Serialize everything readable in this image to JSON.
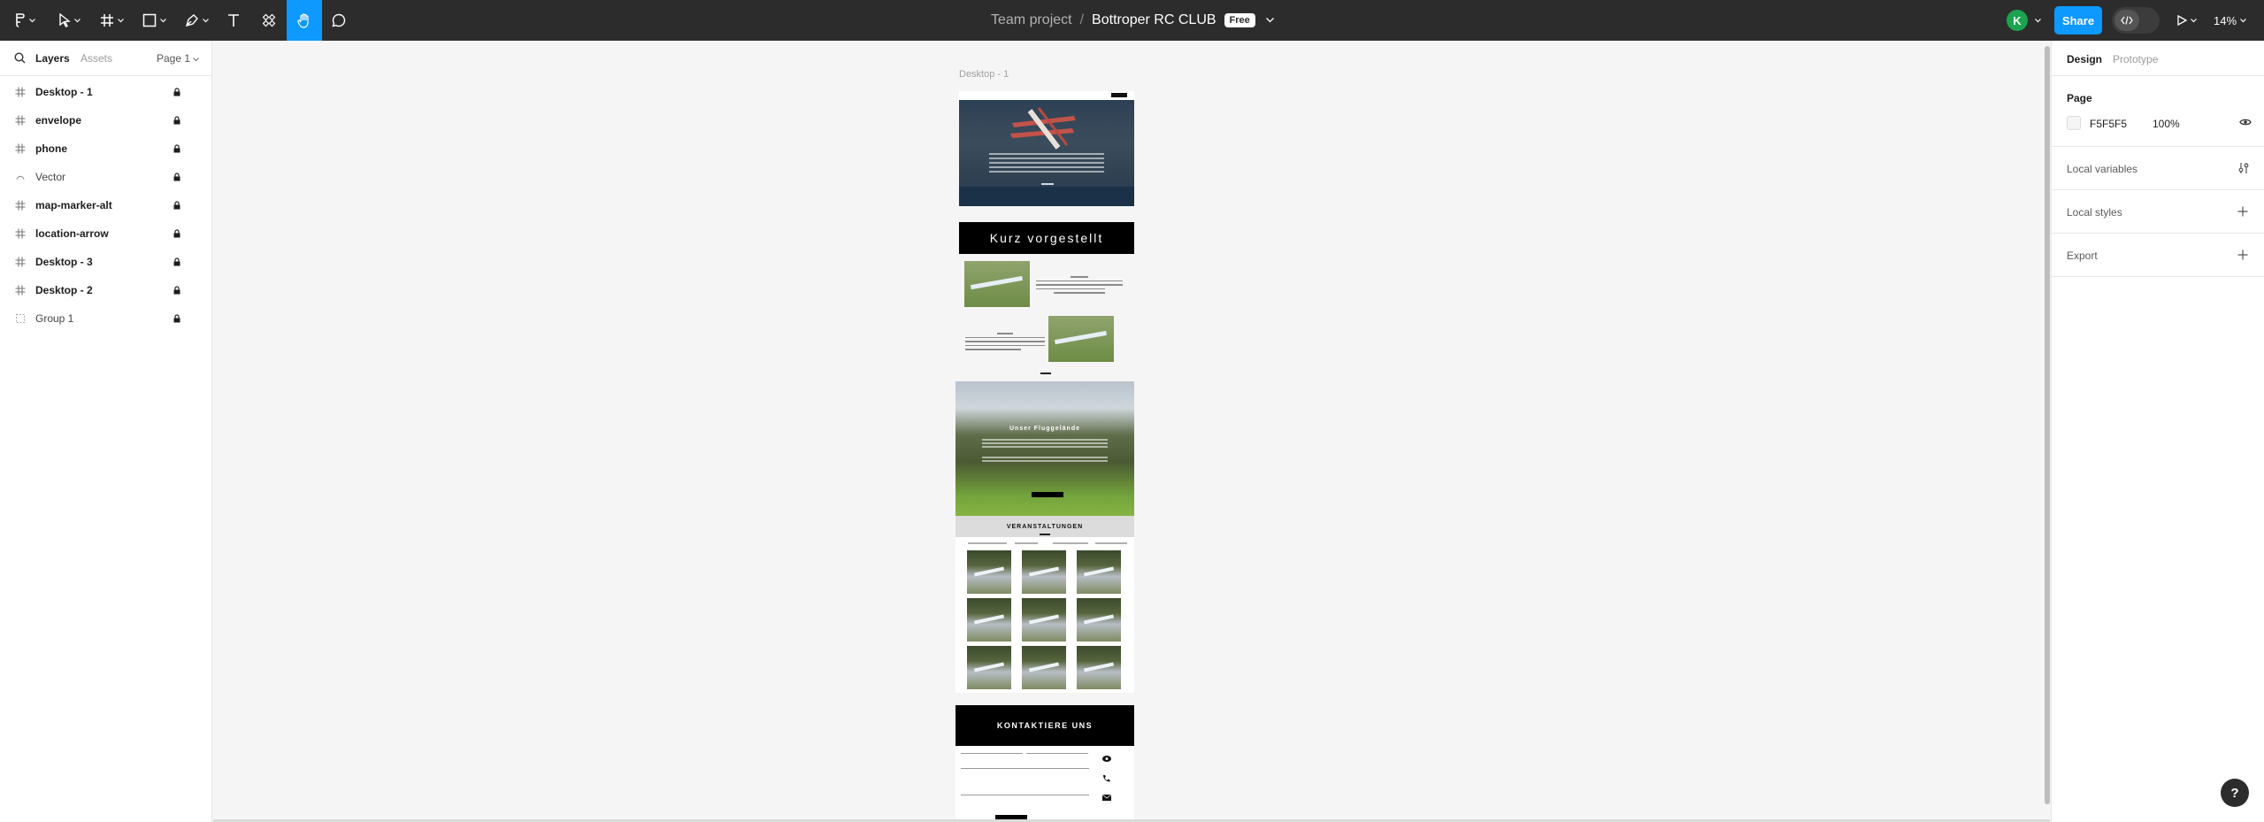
{
  "toolbar": {
    "project": "Team project",
    "separator": "/",
    "file_name": "Bottroper RC CLUB",
    "plan_badge": "Free",
    "user_initial": "K",
    "share_label": "Share",
    "zoom": "14%"
  },
  "left_panel": {
    "tabs": {
      "layers": "Layers",
      "assets": "Assets",
      "page": "Page 1"
    },
    "layers": [
      {
        "name": "Desktop - 1",
        "icon": "frame-icon"
      },
      {
        "name": "envelope",
        "icon": "frame-icon"
      },
      {
        "name": "phone",
        "icon": "frame-icon"
      },
      {
        "name": "Vector",
        "icon": "vector-icon"
      },
      {
        "name": "map-marker-alt",
        "icon": "frame-icon"
      },
      {
        "name": "location-arrow",
        "icon": "frame-icon"
      },
      {
        "name": "Desktop - 3",
        "icon": "frame-icon"
      },
      {
        "name": "Desktop - 2",
        "icon": "frame-icon"
      },
      {
        "name": "Group 1",
        "icon": "group-icon"
      }
    ]
  },
  "canvas": {
    "frame_label": "Desktop - 1",
    "sections": {
      "about_title": "Kurz vorgestellt",
      "field_title": "Unser Fluggelände",
      "events_title": "VERANSTALTUNGEN",
      "contact_title": "KONTAKTIERE UNS"
    }
  },
  "right_panel": {
    "tabs": {
      "design": "Design",
      "prototype": "Prototype"
    },
    "page_heading": "Page",
    "page_color_hex": "F5F5F5",
    "page_opacity": "100%",
    "local_variables": "Local variables",
    "local_styles": "Local styles",
    "export": "Export"
  },
  "help_label": "?",
  "colors": {
    "toolbar_bg": "#2c2c2c",
    "accent": "#0d99ff",
    "avatar": "#1ba34f",
    "canvas_bg": "#F5F5F5"
  }
}
